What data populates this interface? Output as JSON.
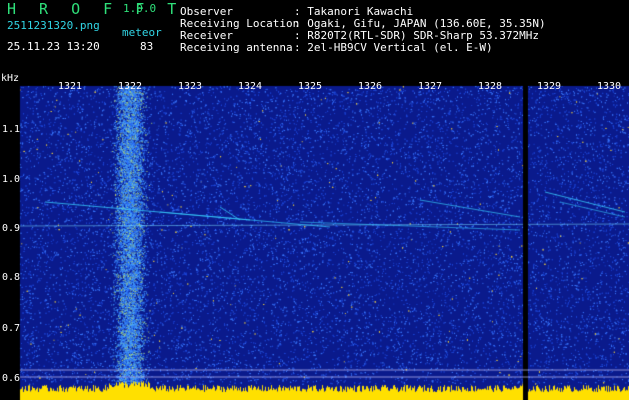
{
  "app": {
    "name": "H R O F F T",
    "version": "1.0.0"
  },
  "file": {
    "filename": "2511231320.png",
    "datetime": "25.11.23 13:20"
  },
  "counter": {
    "label": "meteor",
    "value": "83"
  },
  "info": {
    "rows": [
      {
        "key": "Observer",
        "value": ": Takanori Kawachi"
      },
      {
        "key": "Receiving Location",
        "value": ": Ogaki, Gifu, JAPAN (136.60E, 35.35N)"
      },
      {
        "key": "Receiver",
        "value": ": R820T2(RTL-SDR) SDR-Sharp 53.372MHz"
      },
      {
        "key": "Receiving antenna",
        "value": ": 2el-HB9CV Vertical (el. E-W)"
      }
    ]
  },
  "spectrogram": {
    "y_unit": "kHz",
    "y_ticks": [
      "1.1",
      "1.0",
      "0.9",
      "0.8",
      "0.7",
      "0.6"
    ],
    "x_ticks": [
      "1321",
      "1322",
      "1323",
      "1324",
      "1325",
      "1326",
      "1327",
      "1328",
      "1329",
      "1330"
    ],
    "colors": {
      "background": "#0a1a8c",
      "noise": "#1e50ff",
      "signal": "#ffe000",
      "trace": "#38d0ff"
    }
  }
}
